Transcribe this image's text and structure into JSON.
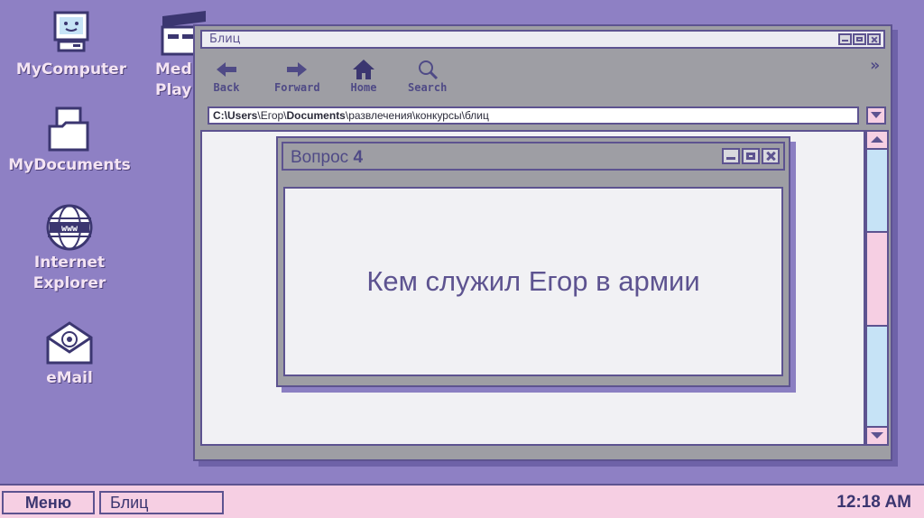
{
  "desktop": {
    "icons": [
      {
        "label": "MyComputer",
        "icon": "computer-icon"
      },
      {
        "label": "MyDocuments",
        "icon": "documents-icon"
      },
      {
        "label": "Internet\nExplorer",
        "icon": "internet-explorer-icon"
      },
      {
        "label": "eMail",
        "icon": "email-icon"
      },
      {
        "label": "Med\nPlay",
        "icon": "media-player-icon"
      }
    ]
  },
  "browser": {
    "title": "Блиц",
    "toolbar": {
      "back": "Back",
      "forward": "Forward",
      "home": "Home",
      "search": "Search",
      "more": "»"
    },
    "address": {
      "drive": "C:\\",
      "users": "Users",
      "sep1": "\\",
      "user": "Егор",
      "sep2": "\\",
      "documents": "Documents",
      "rest": "\\развлечения\\конкурсы\\блиц"
    }
  },
  "dialog": {
    "title_word": "Вопрос",
    "title_number": "4",
    "question": "Кем служил Егор в армии"
  },
  "taskbar": {
    "start_label": "Меню",
    "task_label": "Блиц",
    "clock": "12:18 AM"
  },
  "colors": {
    "desktop": "#8e80c4",
    "window": "#9e9ea4",
    "border": "#5d5390",
    "taskbar": "#f6cfe3",
    "scrollbar": "#c6e3f6"
  }
}
